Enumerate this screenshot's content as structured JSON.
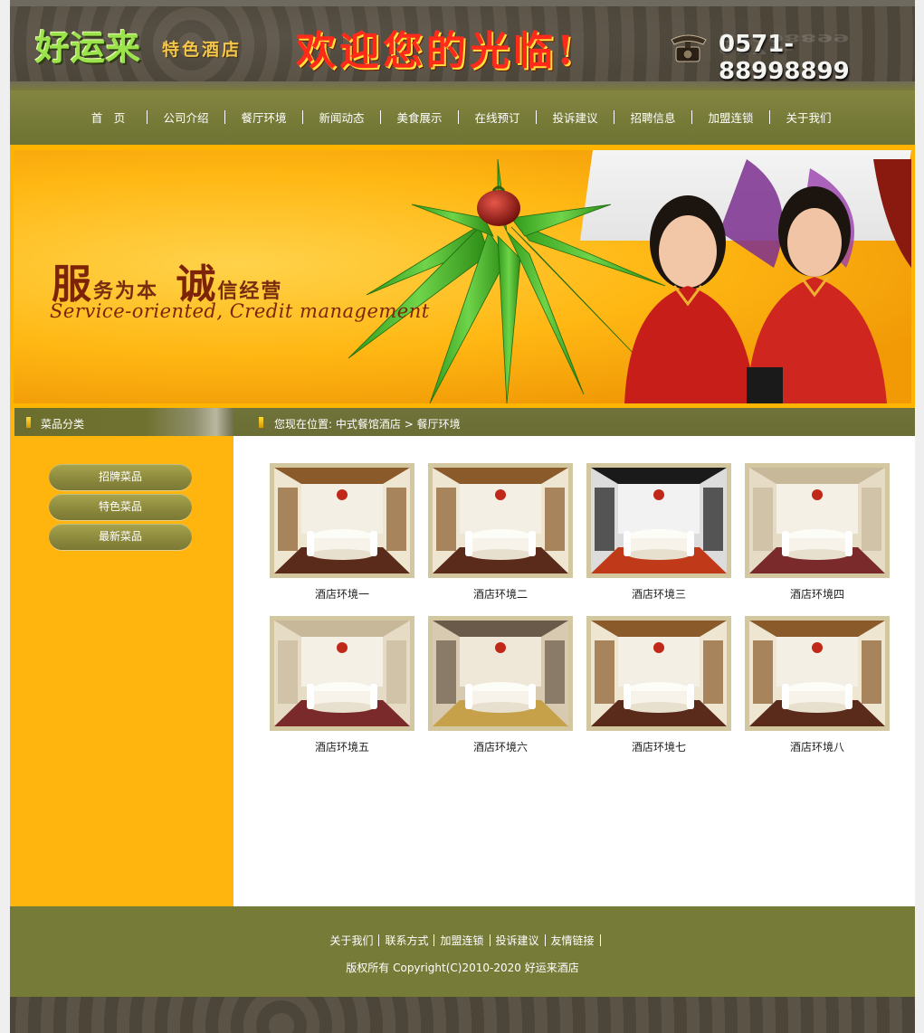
{
  "header": {
    "logo_main": "好运来",
    "logo_sub": "特色酒店",
    "welcome": "欢迎您的光临!",
    "phone": "0571-88998899"
  },
  "nav": {
    "items": [
      {
        "label": "首　页"
      },
      {
        "label": "公司介绍"
      },
      {
        "label": "餐厅环境"
      },
      {
        "label": "新闻动态"
      },
      {
        "label": "美食展示"
      },
      {
        "label": "在线预订"
      },
      {
        "label": "投诉建议"
      },
      {
        "label": "招聘信息"
      },
      {
        "label": "加盟连锁"
      },
      {
        "label": "关于我们"
      }
    ]
  },
  "banner": {
    "slogan_big_1": "服",
    "slogan_rest_1": "务为本",
    "slogan_big_2": "诚",
    "slogan_rest_2": "信经营",
    "slogan_en": "Service-oriented, Credit management"
  },
  "sidebar": {
    "title": "菜品分类",
    "categories": [
      {
        "label": "招牌菜品"
      },
      {
        "label": "特色菜品"
      },
      {
        "label": "最新菜品"
      }
    ]
  },
  "breadcrumb": {
    "prefix": "您现在位置:",
    "home": "中式餐馆酒店",
    "separator": ">",
    "current": "餐厅环境"
  },
  "gallery": {
    "items": [
      {
        "caption": "酒店环境一"
      },
      {
        "caption": "酒店环境二"
      },
      {
        "caption": "酒店环境三"
      },
      {
        "caption": "酒店环境四"
      },
      {
        "caption": "酒店环境五"
      },
      {
        "caption": "酒店环境六"
      },
      {
        "caption": "酒店环境七"
      },
      {
        "caption": "酒店环境八"
      }
    ]
  },
  "footer": {
    "links": [
      {
        "label": "关于我们"
      },
      {
        "label": "联系方式"
      },
      {
        "label": "加盟连锁"
      },
      {
        "label": "投诉建议"
      },
      {
        "label": "友情链接"
      }
    ],
    "copyright": "版权所有 Copyright(C)2010-2020 好运来酒店"
  },
  "colors": {
    "nav_green": "#777b38",
    "accent_orange": "#ffb400",
    "welcome_red": "#ff2a1a"
  }
}
